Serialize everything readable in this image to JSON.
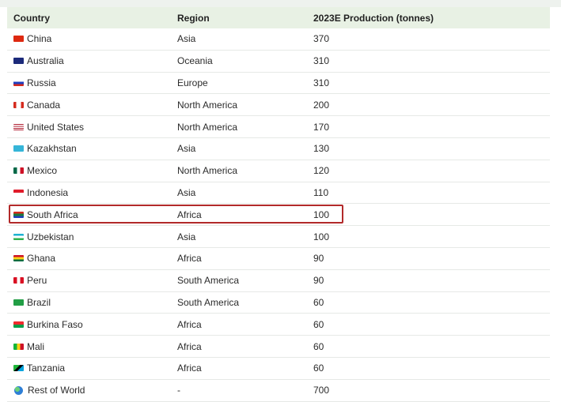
{
  "table": {
    "headers": [
      "Country",
      "Region",
      "2023E Production (tonnes)"
    ],
    "rows": [
      {
        "country": "China",
        "region": "Asia",
        "production": "370",
        "flag": "flag-china"
      },
      {
        "country": "Australia",
        "region": "Oceania",
        "production": "310",
        "flag": "flag-australia"
      },
      {
        "country": "Russia",
        "region": "Europe",
        "production": "310",
        "flag": "flag-russia"
      },
      {
        "country": "Canada",
        "region": "North America",
        "production": "200",
        "flag": "flag-canada"
      },
      {
        "country": "United States",
        "region": "North America",
        "production": "170",
        "flag": "flag-united-states"
      },
      {
        "country": "Kazakhstan",
        "region": "Asia",
        "production": "130",
        "flag": "flag-kazakhstan"
      },
      {
        "country": "Mexico",
        "region": "North America",
        "production": "120",
        "flag": "flag-mexico"
      },
      {
        "country": "Indonesia",
        "region": "Asia",
        "production": "110",
        "flag": "flag-indonesia"
      },
      {
        "country": "South Africa",
        "region": "Africa",
        "production": "100",
        "flag": "flag-south-africa",
        "highlighted": true
      },
      {
        "country": "Uzbekistan",
        "region": "Asia",
        "production": "100",
        "flag": "flag-uzbekistan"
      },
      {
        "country": "Ghana",
        "region": "Africa",
        "production": "90",
        "flag": "flag-ghana"
      },
      {
        "country": "Peru",
        "region": "South America",
        "production": "90",
        "flag": "flag-peru"
      },
      {
        "country": "Brazil",
        "region": "South America",
        "production": "60",
        "flag": "flag-brazil"
      },
      {
        "country": "Burkina Faso",
        "region": "Africa",
        "production": "60",
        "flag": "flag-burkina-faso"
      },
      {
        "country": "Mali",
        "region": "Africa",
        "production": "60",
        "flag": "flag-mali"
      },
      {
        "country": "Tanzania",
        "region": "Africa",
        "production": "60",
        "flag": "flag-tanzania"
      },
      {
        "country": "Rest of World",
        "region": "-",
        "production": "700",
        "flag": "globe-icon"
      }
    ]
  },
  "colors": {
    "header_bg": "#e8f1e4",
    "highlight_border": "#b22a2a"
  }
}
